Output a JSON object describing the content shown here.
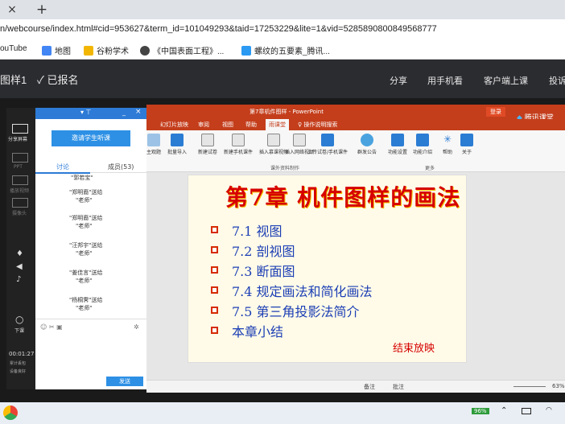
{
  "browser": {
    "tab_close": "×",
    "tab_new": "+",
    "url": "n/webcourse/index.html#cid=953627&term_id=101049293&taid=17253229&lite=1&vid=5285890800849568777",
    "bookmarks": [
      {
        "label": "ouTube",
        "color": "#ff0000"
      },
      {
        "label": "地图",
        "color": "#4285f4"
      },
      {
        "label": "谷粉学术",
        "color": "#f2b600"
      },
      {
        "label": "《中国表面工程》...",
        "color": "#444444"
      },
      {
        "label": "螺纹的五要素_腾讯...",
        "color": "#2b9af3"
      }
    ]
  },
  "header": {
    "course": "图样1",
    "enrolled": "已报名",
    "nav": [
      "分享",
      "用手机看",
      "客户端上课",
      "投诉"
    ]
  },
  "ppt": {
    "title": "第7章机件图样 - PowerPoint",
    "login": "登录",
    "app_name": "腾讯课堂",
    "tabs": [
      "幻灯片放映",
      "审阅",
      "视图",
      "帮助",
      "雨课堂",
      "操作说明搜索"
    ],
    "ribbon": [
      "主观题",
      "批量导入",
      "新建试卷",
      "新建手机课件",
      "插入慕课视频",
      "插入网络视频",
      "上传试卷/手机课件",
      "群发公告",
      "功能设置",
      "功能介绍",
      "帮助",
      "关于"
    ],
    "ribbon_groups": [
      "课外资料制作",
      "更多"
    ],
    "status": [
      "备注",
      "批注",
      "63%"
    ]
  },
  "slide": {
    "title": "第7章  机件图样的画法",
    "items": [
      "7.1  视图",
      "7.2  剖视图",
      "7.3  断面图",
      "7.4  规定画法和简化画法",
      "7.5  第三角投影法简介",
      "本章小结"
    ],
    "end": "结束放映"
  },
  "leftbar": {
    "items": [
      "分享屏幕",
      "PPT",
      "播放视频",
      "摄像头"
    ],
    "lower": [
      "下课"
    ],
    "time": "00:01:27",
    "stats": "累计丢包",
    "stats2": "设备良好"
  },
  "chat": {
    "invite": "邀请学生听课",
    "tab_discuss": "讨论",
    "tab_members": "成员(53)",
    "messages": [
      {
        "who": "\"郭若宝\"",
        "text": ""
      },
      {
        "who": "\"郑明裔\"送给",
        "text": "\"老师\""
      },
      {
        "who": "\"郑明裔\"送给",
        "text": "\"老师\""
      },
      {
        "who": "\"汪邦宇\"送给",
        "text": "\"老师\""
      },
      {
        "who": "\"姜佳言\"送给",
        "text": "\"老师\""
      },
      {
        "who": "\"杨桐霁\"送给",
        "text": "\"老师\""
      }
    ],
    "send": "发送"
  },
  "taskbar": {
    "battery": "96%"
  },
  "colors": {
    "ppt_red": "#c43e1c",
    "slide_title": "#d60000",
    "slide_item": "#1c3fb5",
    "accent_blue": "#2d7bd6"
  }
}
